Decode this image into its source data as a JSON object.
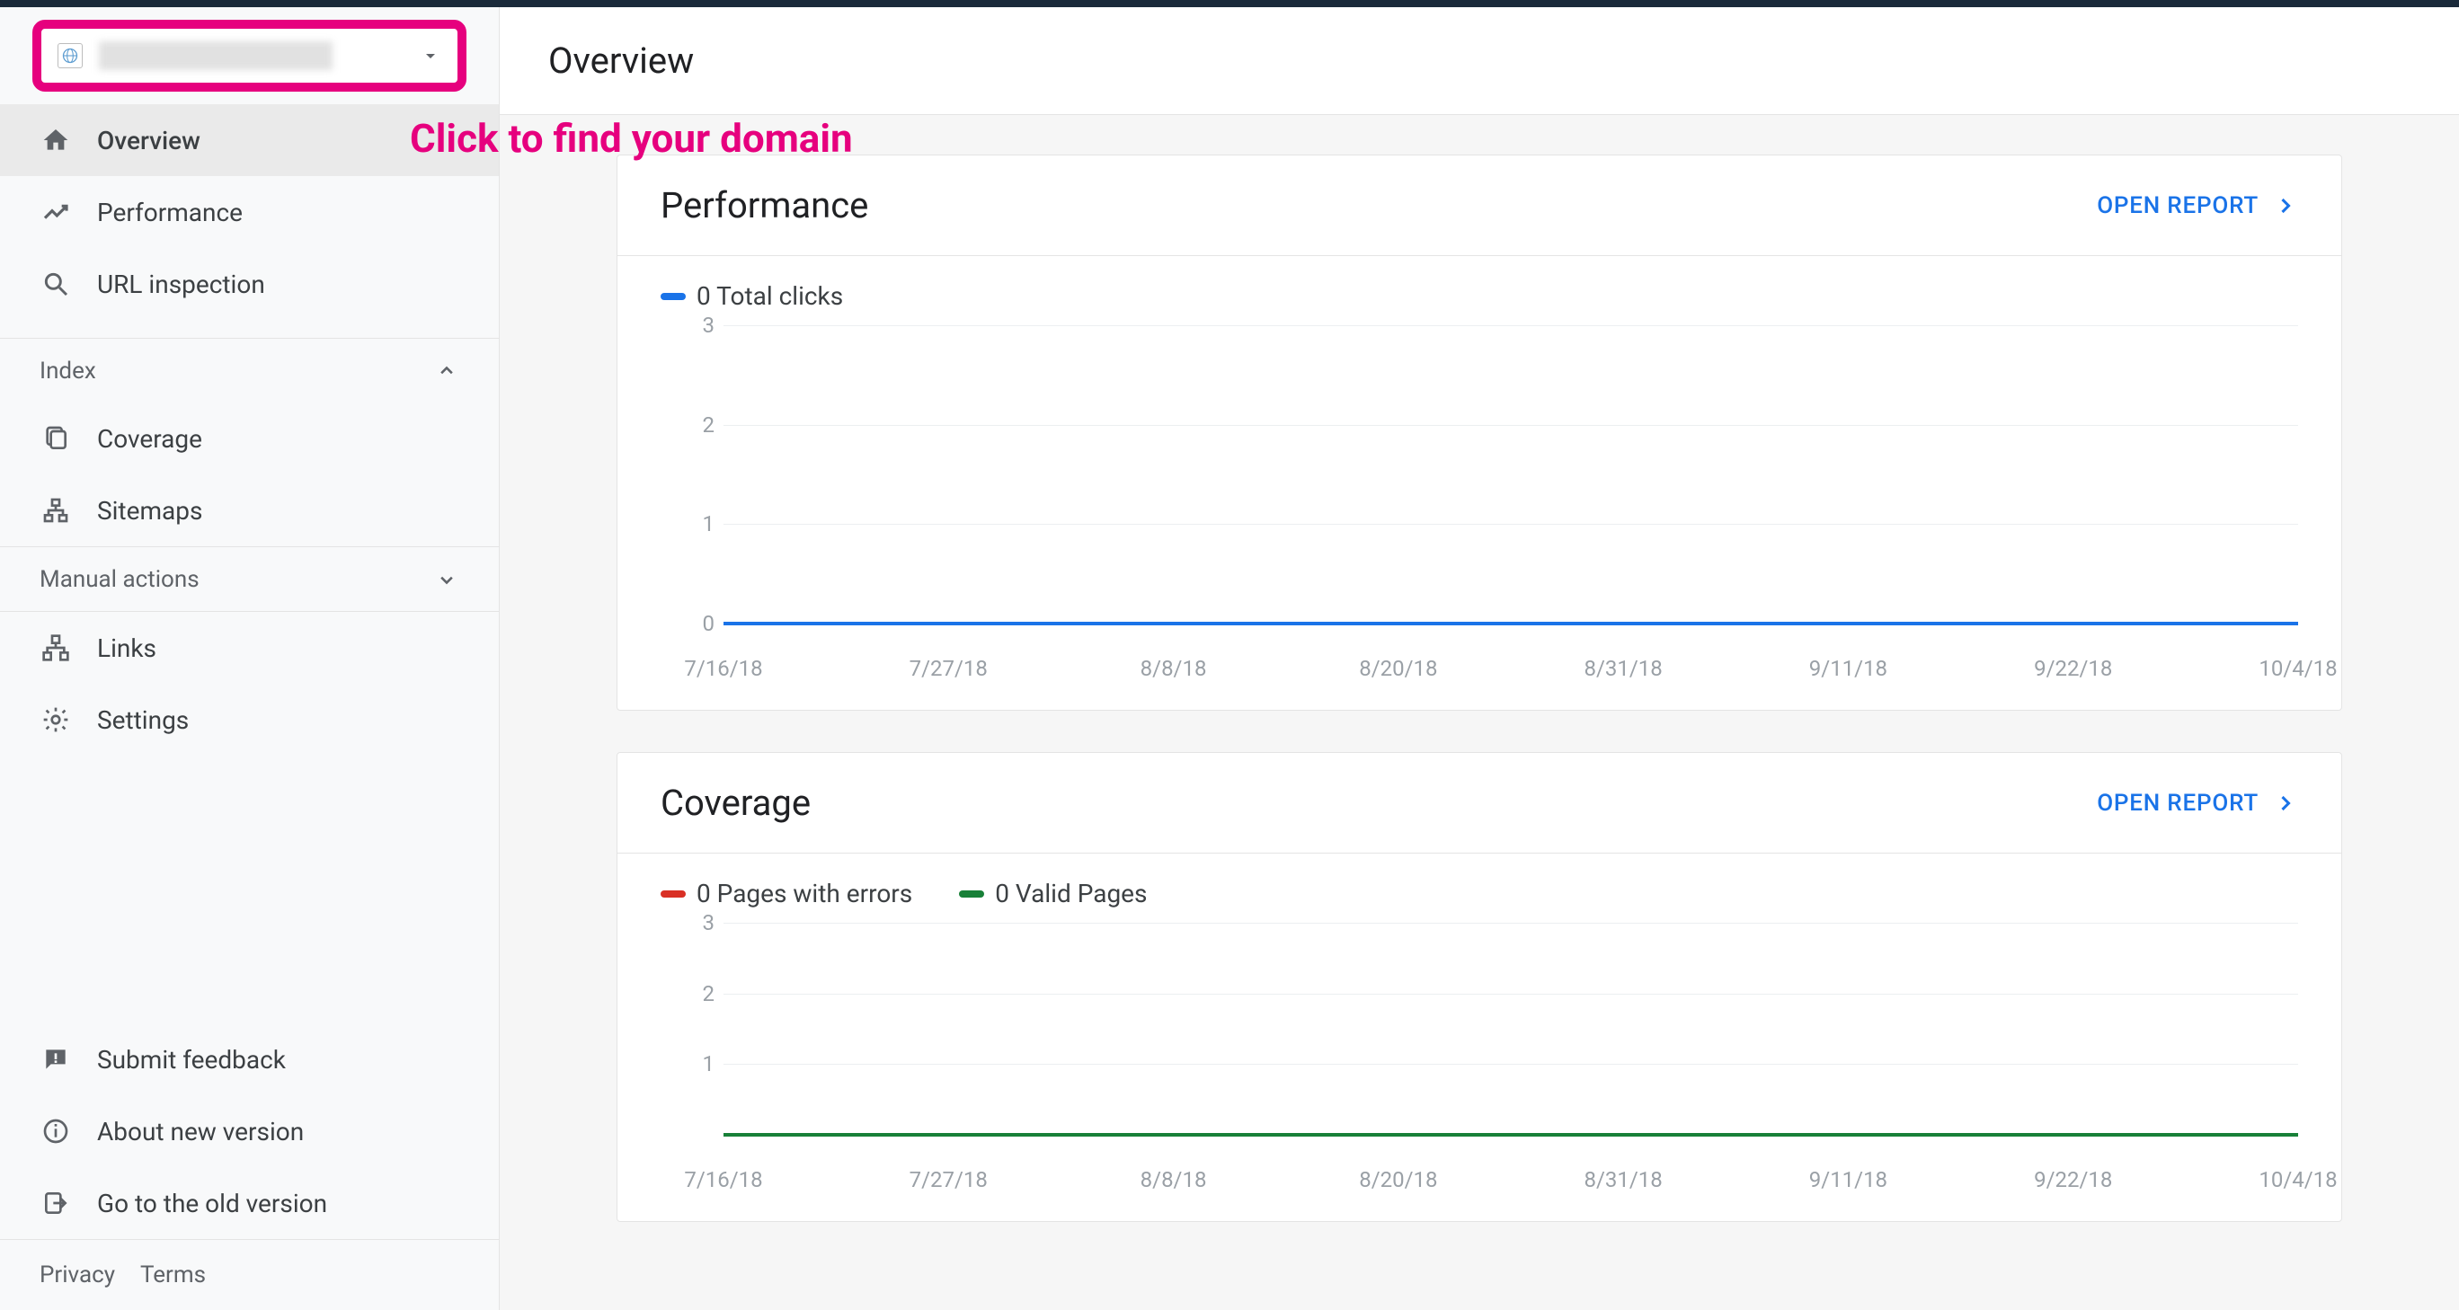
{
  "annotation": "Click to find your domain",
  "header": {
    "title": "Overview"
  },
  "sidebar": {
    "items": [
      {
        "label": "Overview"
      },
      {
        "label": "Performance"
      },
      {
        "label": "URL inspection"
      }
    ],
    "section_index": {
      "label": "Index"
    },
    "index_items": [
      {
        "label": "Coverage"
      },
      {
        "label": "Sitemaps"
      }
    ],
    "section_manual": {
      "label": "Manual actions"
    },
    "lower_items": [
      {
        "label": "Links"
      },
      {
        "label": "Settings"
      }
    ],
    "bottom_items": [
      {
        "label": "Submit feedback"
      },
      {
        "label": "About new version"
      },
      {
        "label": "Go to the old version"
      }
    ],
    "footer": {
      "privacy": "Privacy",
      "terms": "Terms"
    }
  },
  "cards": {
    "performance": {
      "title": "Performance",
      "open_report": "OPEN REPORT",
      "legend": [
        {
          "label": "0 Total clicks",
          "color": "#1a73e8"
        }
      ]
    },
    "coverage": {
      "title": "Coverage",
      "open_report": "OPEN REPORT",
      "legend": [
        {
          "label": "0 Pages with errors",
          "color": "#d93025"
        },
        {
          "label": "0 Valid Pages",
          "color": "#188038"
        }
      ]
    }
  },
  "chart_data": [
    {
      "type": "line",
      "title": "Performance",
      "series": [
        {
          "name": "Total clicks",
          "color": "#1a73e8",
          "values": [
            0,
            0,
            0,
            0,
            0,
            0,
            0,
            0
          ]
        }
      ],
      "x_ticks": [
        "7/16/18",
        "7/27/18",
        "8/8/18",
        "8/20/18",
        "8/31/18",
        "9/11/18",
        "9/22/18",
        "10/4/18"
      ],
      "y_ticks": [
        0,
        1,
        2,
        3
      ],
      "ylim": [
        0,
        3
      ]
    },
    {
      "type": "line",
      "title": "Coverage",
      "series": [
        {
          "name": "Pages with errors",
          "color": "#d93025",
          "values": [
            0,
            0,
            0,
            0,
            0,
            0,
            0,
            0
          ]
        },
        {
          "name": "Valid Pages",
          "color": "#188038",
          "values": [
            0,
            0,
            0,
            0,
            0,
            0,
            0,
            0
          ]
        }
      ],
      "x_ticks": [
        "7/16/18",
        "7/27/18",
        "8/8/18",
        "8/20/18",
        "8/31/18",
        "9/11/18",
        "9/22/18",
        "10/4/18"
      ],
      "y_ticks": [
        1,
        2,
        3
      ],
      "ylim": [
        0,
        3
      ]
    }
  ]
}
